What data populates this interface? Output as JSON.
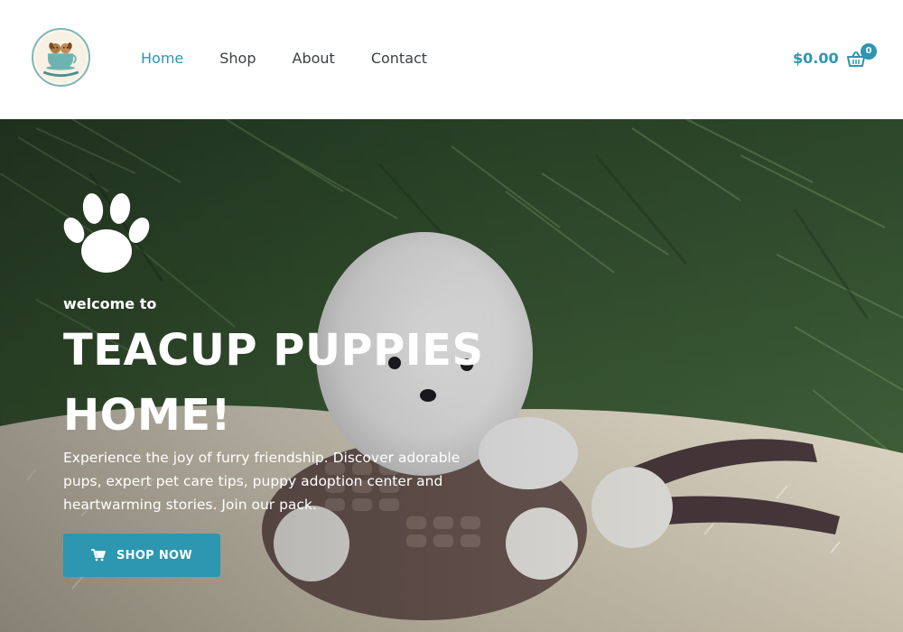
{
  "brand": {
    "logo_icon": "teacup-puppies-logo",
    "logo_text": "TEACUP PUPPIES HOME"
  },
  "nav": {
    "items": [
      {
        "label": "Home",
        "active": true
      },
      {
        "label": "Shop",
        "active": false
      },
      {
        "label": "About",
        "active": false
      },
      {
        "label": "Contact",
        "active": false
      }
    ]
  },
  "cart": {
    "total": "$0.00",
    "count": "0",
    "icon": "basket-icon"
  },
  "hero": {
    "icon": "paw-icon",
    "welcome": "welcome to",
    "title": "TEACUP PUPPIES HOME!",
    "description": "Experience the joy of furry friendship. Discover adorable pups, expert pet care tips, puppy adoption center and heartwarming stories. Join our pack.",
    "button_label": "SHOP NOW",
    "button_icon": "cart-icon"
  },
  "colors": {
    "accent": "#2d96b0",
    "nav_text": "#3b3f45",
    "hero_text": "#ffffff"
  }
}
